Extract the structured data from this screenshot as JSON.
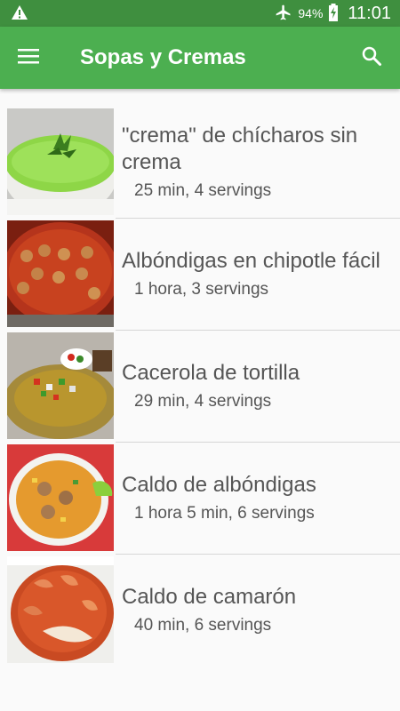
{
  "status": {
    "battery": "94%",
    "time": "11:01"
  },
  "app_bar": {
    "title": "Sopas y Cremas"
  },
  "recipes": [
    {
      "name": "\"crema\" de chícharos sin crema",
      "meta": "25 min, 4 servings"
    },
    {
      "name": "Albóndigas en chipotle fácil",
      "meta": "1 hora, 3 servings"
    },
    {
      "name": "Cacerola de tortilla",
      "meta": "29 min, 4 servings"
    },
    {
      "name": "Caldo de albóndigas",
      "meta": "1 hora 5 min, 6 servings"
    },
    {
      "name": "Caldo de camarón",
      "meta": "40 min, 6 servings"
    }
  ],
  "colors": {
    "app_bar": "#4caf50",
    "status_bar": "#3f8f3f",
    "text": "#555555"
  }
}
